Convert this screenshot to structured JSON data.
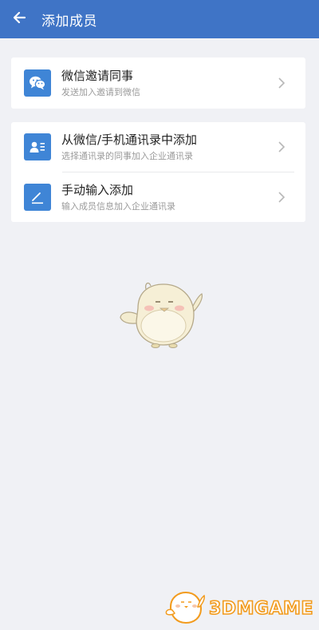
{
  "header": {
    "title": "添加成员",
    "back_icon": "arrow-left-icon"
  },
  "invite_card": {
    "items": [
      {
        "title": "微信邀请同事",
        "subtitle": "发送加入邀请到微信",
        "icon": "wechat-icon"
      }
    ]
  },
  "add_card": {
    "items": [
      {
        "title": "从微信/手机通讯录中添加",
        "subtitle": "选择通讯录的同事加入企业通讯录",
        "icon": "contact-card-icon"
      },
      {
        "title": "手动输入添加",
        "subtitle": "输入成员信息加入企业通讯录",
        "icon": "pencil-icon"
      }
    ]
  },
  "watermark": {
    "text": "3DMGAME"
  },
  "colors": {
    "header": "#3f74c6",
    "icon_bg": "#3f85d6",
    "background": "#f0f1f5",
    "watermark_orange": "#f29b1d"
  }
}
